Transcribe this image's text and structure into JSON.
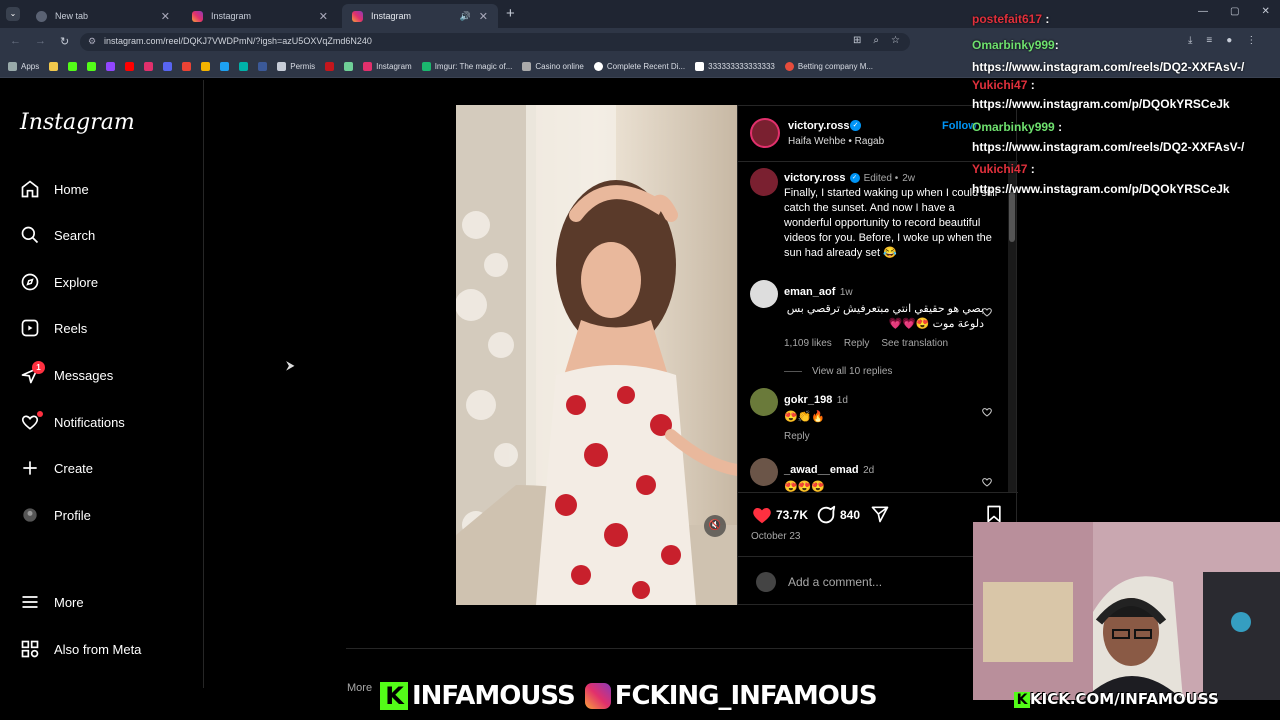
{
  "browser": {
    "tabs": [
      {
        "label": "New tab"
      },
      {
        "label": "Instagram"
      },
      {
        "label": "Instagram"
      }
    ],
    "url": "instagram.com/reel/DQKJ7VWDPmN/?igsh=azU5OXVqZmd6N240",
    "bookmarks": [
      "Apps",
      "Permis",
      "Instagram",
      "Imgur: The magic of...",
      "Casino online",
      "Complete Recent Di...",
      "333333333333333",
      "Betting company M..."
    ]
  },
  "sidebar": {
    "logo": "Instagram",
    "items": [
      {
        "label": "Home",
        "icon": "home-icon"
      },
      {
        "label": "Search",
        "icon": "search-icon"
      },
      {
        "label": "Explore",
        "icon": "compass-icon"
      },
      {
        "label": "Reels",
        "icon": "reels-icon"
      },
      {
        "label": "Messages",
        "icon": "messenger-icon",
        "badge": "1"
      },
      {
        "label": "Notifications",
        "icon": "heart-icon"
      },
      {
        "label": "Create",
        "icon": "plus-icon"
      },
      {
        "label": "Profile",
        "icon": "avatar-icon"
      },
      {
        "label": "More",
        "icon": "menu-icon"
      },
      {
        "label": "Also from Meta",
        "icon": "meta-icon"
      }
    ]
  },
  "post": {
    "author": "victory.ross",
    "audio": "Haifa Wehbe • Ragab",
    "follow": "Follow",
    "caption_meta_edited": "Edited •",
    "caption_meta_age": "2w",
    "caption": "Finally, I started waking up when I could still catch the sunset. And now I have a wonderful opportunity to record beautiful videos for you. Before, I woke up when the sun had already set 😂",
    "comments": [
      {
        "user": "eman_aof",
        "age": "1w",
        "text": "بصي هو حقيقي انتي مبتعرفيش ترقصي بس دلوعة موت 😍💗💗",
        "likes": "1,109 likes",
        "reply": "Reply",
        "translate": "See translation",
        "view_replies": "View all 10 replies"
      },
      {
        "user": "gokr_198",
        "age": "1d",
        "text": "😍👏🔥",
        "reply": "Reply"
      },
      {
        "user": "_awad__emad",
        "age": "2d",
        "text": "😍😍😍"
      }
    ],
    "likes": "73.7K",
    "comments_count": "840",
    "date": "October 23",
    "add_comment_placeholder": "Add a comment...",
    "more_label": "More"
  },
  "chat": [
    {
      "user": "postefait617",
      "text": ":"
    },
    {
      "user": "Omarbinky999",
      "text": ": https://www.instagram.com/reels/DQ2-XXFAsV-/"
    },
    {
      "user": "Yukichi47",
      "text": ":"
    },
    {
      "link": "https://www.instagram.com/p/DQOkYRSCeJk"
    },
    {
      "user": "Omarbinky999",
      "text": ":"
    },
    {
      "link": "https://www.instagram.com/reels/DQ2-XXFAsV-/"
    },
    {
      "user": "Yukichi47",
      "text": ":"
    },
    {
      "link": "https://www.instagram.com/p/DQOkYRSCeJk"
    }
  ],
  "overlay": {
    "banner_kick": "INFAMOUSS",
    "banner_ig": "FCKING_INFAMOUS",
    "kick_url": "KICK.COM/INFAMOUSS"
  },
  "colors": {
    "instagram_red": "#ff3040",
    "link_blue": "#0095f6",
    "kick_green": "#53fc18"
  }
}
